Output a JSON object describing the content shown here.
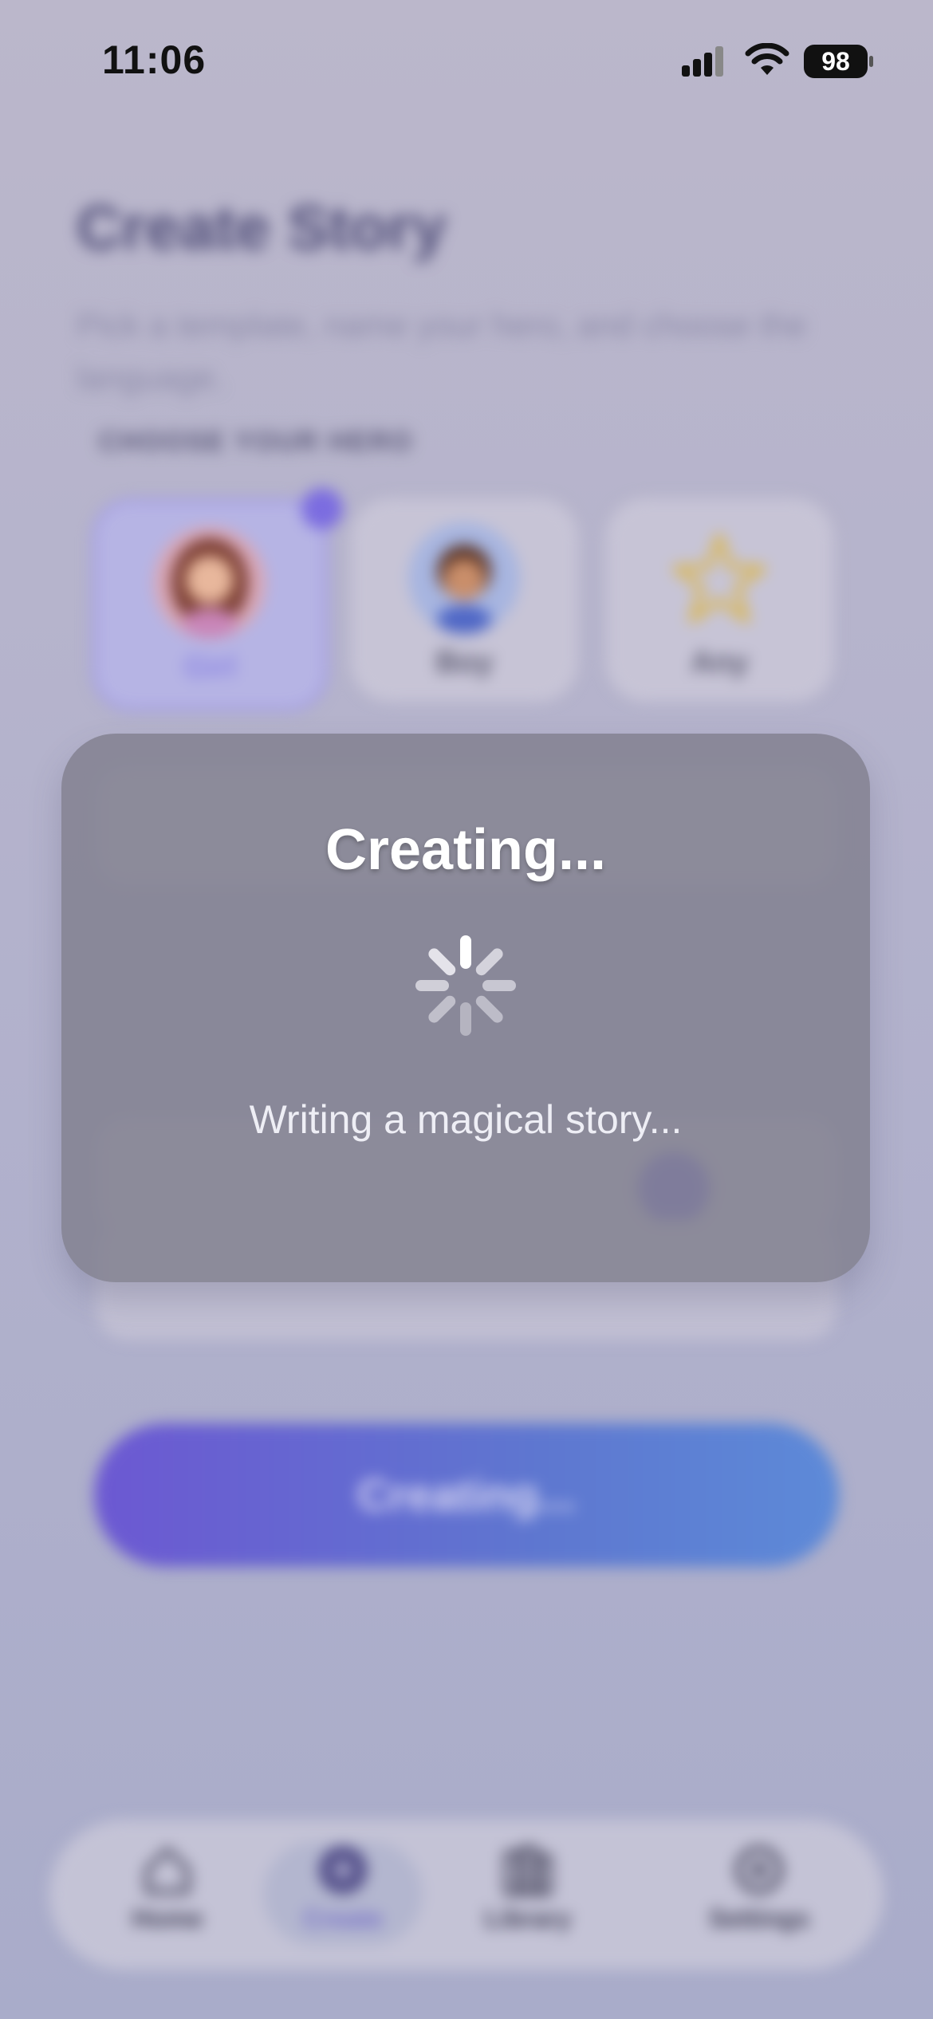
{
  "status_bar": {
    "time": "11:06",
    "battery": "98"
  },
  "page": {
    "title": "Create Story",
    "subtitle": "Pick a template, name your hero, and choose the language.",
    "section_label": "CHOOSE YOUR HERO"
  },
  "hero_options": [
    {
      "label": "Girl",
      "selected": true
    },
    {
      "label": "Boy",
      "selected": false
    },
    {
      "label": "Any",
      "selected": false
    }
  ],
  "create_button": {
    "label": "Creating..."
  },
  "tabs": [
    {
      "label": "Home",
      "icon": "house-icon"
    },
    {
      "label": "Create",
      "icon": "plus-circle-icon",
      "active": true
    },
    {
      "label": "Library",
      "icon": "books-icon"
    },
    {
      "label": "Settings",
      "icon": "gear-icon"
    }
  ],
  "modal": {
    "title": "Creating...",
    "message": "Writing a magical story..."
  }
}
